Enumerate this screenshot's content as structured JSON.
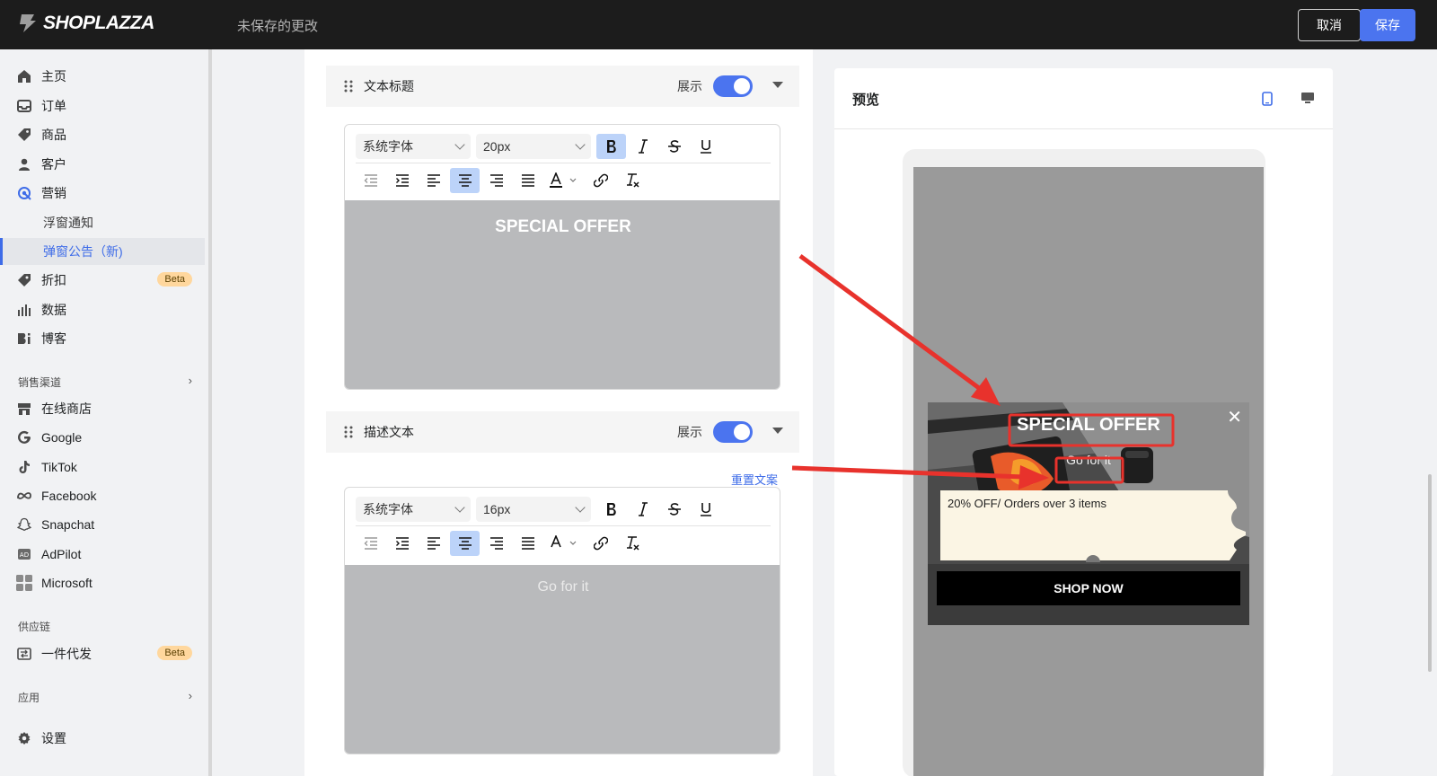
{
  "topbar": {
    "brand": "SHOPLAZZA",
    "status": "未保存的更改",
    "cancel_label": "取消",
    "save_label": "保存"
  },
  "sidebar": {
    "items": [
      {
        "label": "主页",
        "icon": "home-icon"
      },
      {
        "label": "订单",
        "icon": "inbox-icon"
      },
      {
        "label": "商品",
        "icon": "tag-icon"
      },
      {
        "label": "客户",
        "icon": "person-icon"
      },
      {
        "label": "营销",
        "icon": "marketing-icon"
      },
      {
        "label": "浮窗通知",
        "sub": true
      },
      {
        "label": "弹窗公告（新)",
        "sub": true,
        "active": true
      },
      {
        "label": "折扣",
        "icon": "discount-icon",
        "badge": "Beta"
      },
      {
        "label": "数据",
        "icon": "bar-chart-icon"
      },
      {
        "label": "博客",
        "icon": "blog-icon"
      }
    ],
    "sales_channels_heading": "销售渠道",
    "channels": [
      {
        "label": "在线商店",
        "icon": "store-icon"
      },
      {
        "label": "Google",
        "icon": "google-icon"
      },
      {
        "label": "TikTok",
        "icon": "tiktok-icon"
      },
      {
        "label": "Facebook",
        "icon": "meta-icon"
      },
      {
        "label": "Snapchat",
        "icon": "snapchat-icon"
      },
      {
        "label": "AdPilot",
        "icon": "adpilot-icon"
      },
      {
        "label": "Microsoft",
        "icon": "microsoft-icon"
      }
    ],
    "supply_heading": "供应链",
    "supply_items": [
      {
        "label": "一件代发",
        "icon": "dropship-icon",
        "badge": "Beta"
      }
    ],
    "apps_heading": "应用",
    "settings_label": "设置"
  },
  "editor": {
    "sections": [
      {
        "title": "文本标题",
        "show_label": "展示",
        "font": "系统字体",
        "size": "20px",
        "content": "SPECIAL OFFER"
      },
      {
        "title": "描述文本",
        "show_label": "展示",
        "reset_label": "重置文案",
        "font": "系统字体",
        "size": "16px",
        "content": "Go for it"
      }
    ]
  },
  "preview": {
    "title": "预览",
    "popup": {
      "title": "SPECIAL OFFER",
      "subtitle": "Go for it",
      "coupon_text": "20% OFF/ Orders over 3 items",
      "cta": "SHOP NOW",
      "close": "✕"
    }
  },
  "colors": {
    "accent": "#4b74ef",
    "annotation": "#e8322c",
    "topbar": "#1c1c1c"
  }
}
